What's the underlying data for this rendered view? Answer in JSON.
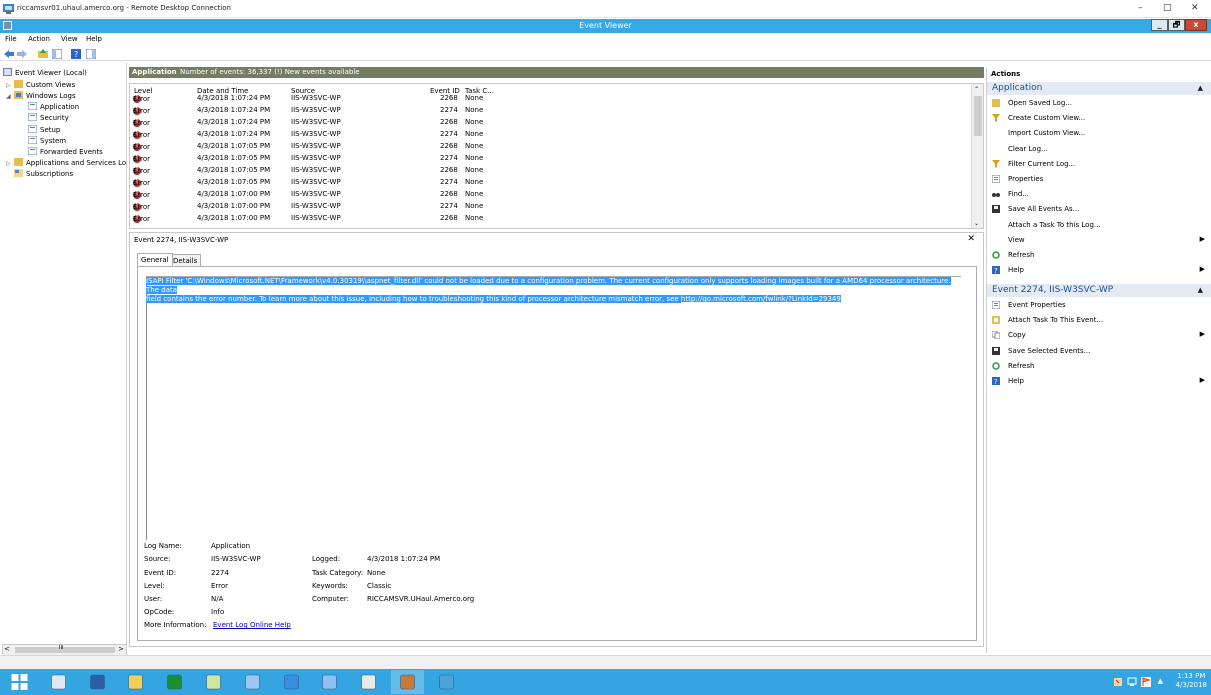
{
  "rdc_title": "riccamsvr01.uhaul.amerco.org - Remote Desktop Connection",
  "rdc_controls": {
    "minimize": "–",
    "maximize": "□",
    "close": "✕"
  },
  "window_title": "Event Viewer",
  "window_buttons": {
    "minimize": "_",
    "maximize": "🗗",
    "close": "x"
  },
  "menu": [
    "File",
    "Action",
    "View",
    "Help"
  ],
  "tree": [
    {
      "label": "Event Viewer (Local)",
      "icon": "event-viewer-icon"
    },
    {
      "label": "Custom Views",
      "icon": "folder-icon"
    },
    {
      "label": "Windows Logs",
      "icon": "folder-icon"
    },
    {
      "label": "Application",
      "icon": "log-icon"
    },
    {
      "label": "Security",
      "icon": "log-icon"
    },
    {
      "label": "Setup",
      "icon": "log-icon"
    },
    {
      "label": "System",
      "icon": "log-icon"
    },
    {
      "label": "Forwarded Events",
      "icon": "log-icon"
    },
    {
      "label": "Applications and Services Lo",
      "icon": "folder-icon"
    },
    {
      "label": "Subscriptions",
      "icon": "subscriptions-icon"
    }
  ],
  "scroll_thumb_glyph": "III",
  "log_header": {
    "name": "Application",
    "info": "Number of events: 36,337 (!) New events available"
  },
  "columns": {
    "level": "Level",
    "datetime": "Date and Time",
    "source": "Source",
    "eventid": "Event ID",
    "task": "Task C..."
  },
  "events": [
    {
      "level": "Error",
      "datetime": "4/3/2018 1:07:24 PM",
      "source": "IIS-W3SVC-WP",
      "eventid": "2268",
      "task": "None"
    },
    {
      "level": "Error",
      "datetime": "4/3/2018 1:07:24 PM",
      "source": "IIS-W3SVC-WP",
      "eventid": "2274",
      "task": "None"
    },
    {
      "level": "Error",
      "datetime": "4/3/2018 1:07:24 PM",
      "source": "IIS-W3SVC-WP",
      "eventid": "2268",
      "task": "None"
    },
    {
      "level": "Error",
      "datetime": "4/3/2018 1:07:24 PM",
      "source": "IIS-W3SVC-WP",
      "eventid": "2274",
      "task": "None"
    },
    {
      "level": "Error",
      "datetime": "4/3/2018 1:07:05 PM",
      "source": "IIS-W3SVC-WP",
      "eventid": "2268",
      "task": "None"
    },
    {
      "level": "Error",
      "datetime": "4/3/2018 1:07:05 PM",
      "source": "IIS-W3SVC-WP",
      "eventid": "2274",
      "task": "None"
    },
    {
      "level": "Error",
      "datetime": "4/3/2018 1:07:05 PM",
      "source": "IIS-W3SVC-WP",
      "eventid": "2268",
      "task": "None"
    },
    {
      "level": "Error",
      "datetime": "4/3/2018 1:07:05 PM",
      "source": "IIS-W3SVC-WP",
      "eventid": "2274",
      "task": "None"
    },
    {
      "level": "Error",
      "datetime": "4/3/2018 1:07:00 PM",
      "source": "IIS-W3SVC-WP",
      "eventid": "2268",
      "task": "None"
    },
    {
      "level": "Error",
      "datetime": "4/3/2018 1:07:00 PM",
      "source": "IIS-W3SVC-WP",
      "eventid": "2274",
      "task": "None"
    },
    {
      "level": "Error",
      "datetime": "4/3/2018 1:07:00 PM",
      "source": "IIS-W3SVC-WP",
      "eventid": "2268",
      "task": "None"
    }
  ],
  "detail": {
    "title": "Event 2274, IIS-W3SVC-WP",
    "close": "✕",
    "tabs": [
      "General",
      "Details"
    ],
    "message_line1": "ISAPI Filter 'C:\\Windows\\Microsoft.NET\\Framework\\v4.0.30319\\\\aspnet_filter.dll' could not be loaded due to a configuration problem. The current configuration only supports loading images built for a AMD64 processor architecture. The data",
    "message_line2": "field contains the error number. To learn more about this issue, including how to troubleshooting this kind of processor architecture mismatch error, see ",
    "message_link": "http://go.microsoft.com/fwlink/?LinkId=29349",
    "fields": {
      "log_name_label": "Log Name:",
      "log_name": "Application",
      "source_label": "Source:",
      "source": "IIS-W3SVC-WP",
      "logged_label": "Logged:",
      "logged": "4/3/2018 1:07:24 PM",
      "event_id_label": "Event ID:",
      "event_id": "2274",
      "task_category_label": "Task Category:",
      "task_category": "None",
      "level_label": "Level:",
      "level": "Error",
      "keywords_label": "Keywords:",
      "keywords": "Classic",
      "user_label": "User:",
      "user": "N/A",
      "computer_label": "Computer:",
      "computer": "RICCAMSVR.UHaul.Amerco.org",
      "opcode_label": "OpCode:",
      "opcode": "Info",
      "more_info_label": "More Information:",
      "more_info_link": "Event Log Online Help"
    }
  },
  "actions": {
    "header": "Actions",
    "section1": "Application",
    "section1_items": [
      {
        "label": "Open Saved Log...",
        "icon": "folder-open-icon",
        "submenu": false
      },
      {
        "label": "Create Custom View...",
        "icon": "filter-icon",
        "submenu": false
      },
      {
        "label": "Import Custom View...",
        "icon": "",
        "submenu": false
      },
      {
        "label": "Clear Log...",
        "icon": "",
        "submenu": false
      },
      {
        "label": "Filter Current Log...",
        "icon": "filter-icon",
        "submenu": false
      },
      {
        "label": "Properties",
        "icon": "properties-icon",
        "submenu": false
      },
      {
        "label": "Find...",
        "icon": "binoculars-icon",
        "submenu": false
      },
      {
        "label": "Save All Events As...",
        "icon": "save-icon",
        "submenu": false
      },
      {
        "label": "Attach a Task To this Log...",
        "icon": "",
        "submenu": false
      },
      {
        "label": "View",
        "icon": "",
        "submenu": true
      },
      {
        "label": "Refresh",
        "icon": "refresh-icon",
        "submenu": false
      },
      {
        "label": "Help",
        "icon": "help-icon",
        "submenu": true
      }
    ],
    "section2": "Event 2274, IIS-W3SVC-WP",
    "section2_items": [
      {
        "label": "Event Properties",
        "icon": "properties-icon",
        "submenu": false
      },
      {
        "label": "Attach Task To This Event...",
        "icon": "task-icon",
        "submenu": false
      },
      {
        "label": "Copy",
        "icon": "copy-icon",
        "submenu": true
      },
      {
        "label": "Save Selected Events...",
        "icon": "save-icon",
        "submenu": false
      },
      {
        "label": "Refresh",
        "icon": "refresh-icon",
        "submenu": false
      },
      {
        "label": "Help",
        "icon": "help-icon",
        "submenu": true
      }
    ]
  },
  "taskbar": {
    "apps": [
      "start-icon",
      "server-manager-icon",
      "powershell-icon",
      "file-explorer-icon",
      "store-icon",
      "network-icon",
      "remote-desktop-icon",
      "ie-icon",
      "control-panel-icon",
      "settings-icon",
      "event-viewer-icon",
      "components-icon"
    ],
    "tray_chevron": "▲",
    "time": "1:13 PM",
    "date": "4/3/2018"
  },
  "colors": {
    "title_bar": "#35a9e6",
    "taskbar": "#34a5e1",
    "log_header": "#747d61",
    "selection": "#3399ff",
    "error": "#c81e1e",
    "action_header": "#1d4f91"
  }
}
